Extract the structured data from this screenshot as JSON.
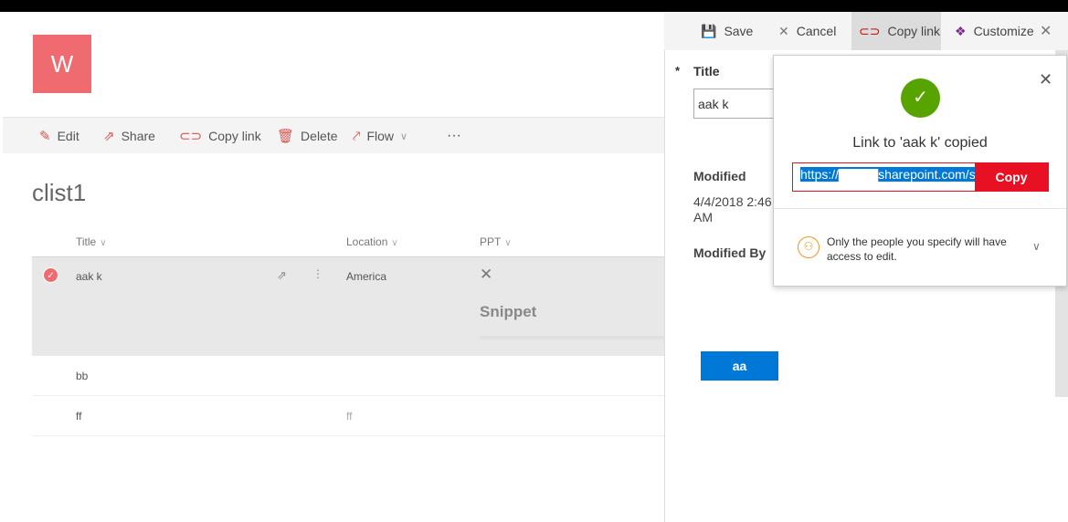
{
  "site": {
    "logo_letter": "W",
    "list_title": "clist1"
  },
  "commands": [
    {
      "label": "Edit",
      "icon": "pencil-icon"
    },
    {
      "label": "Share",
      "icon": "share-icon"
    },
    {
      "label": "Copy link",
      "icon": "link-icon"
    },
    {
      "label": "Delete",
      "icon": "trash-icon"
    },
    {
      "label": "Flow",
      "icon": "flow-icon"
    }
  ],
  "more": "···",
  "columns": {
    "title": "Title",
    "location": "Location",
    "ppt": "PPT"
  },
  "rows": [
    {
      "title": "aak k",
      "location": "America",
      "ppt_status": "✕",
      "ppt_snippet": "Snippet",
      "selected": true
    },
    {
      "title": "bb",
      "location": ""
    },
    {
      "title": "ff",
      "location": "ff"
    }
  ],
  "panel": {
    "save": "Save",
    "cancel": "Cancel",
    "copy_link": "Copy link",
    "customize": "Customize",
    "title_label": "Title",
    "required_mark": "*",
    "title_value": "aak k",
    "modified_label": "Modified",
    "modified_value": "4/4/2018 2:46 AM",
    "modified_by_label": "Modified By",
    "button_label": "aa"
  },
  "popup": {
    "message": "Link to 'aak k' copied",
    "url": "https://▇▇▇▇sharepoint.com/si",
    "copy_button": "Copy",
    "permission_text": "Only the people you specify will have access to edit."
  },
  "colors": {
    "accent": "#f06b70",
    "success": "#57a300",
    "copy_button": "#e81123",
    "selection": "#0078d7",
    "primary_button": "#0078d7"
  }
}
